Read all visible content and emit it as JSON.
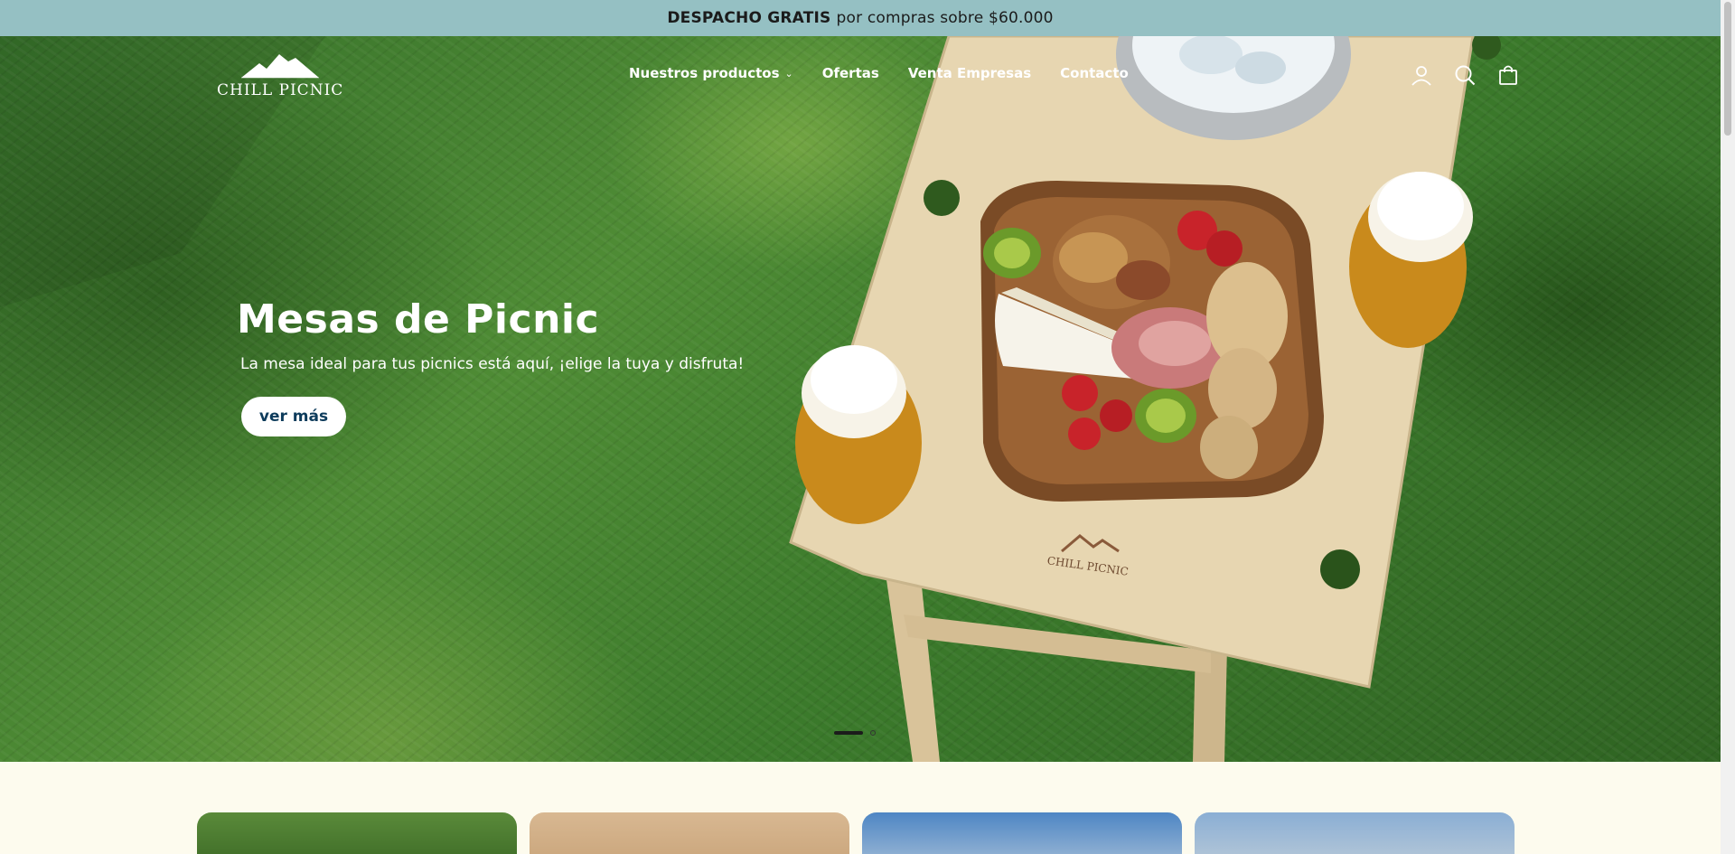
{
  "announcement": {
    "bold": "DESPACHO GRATIS",
    "text": "por compras sobre $60.000"
  },
  "brand": {
    "name": "CHILL PICNIC",
    "logo_icon": "mountain-icon"
  },
  "nav": {
    "items": [
      {
        "label": "Nuestros productos",
        "has_dropdown": true
      },
      {
        "label": "Ofertas"
      },
      {
        "label": "Venta Empresas"
      },
      {
        "label": "Contacto"
      }
    ]
  },
  "header_icons": [
    "account-icon",
    "search-icon",
    "cart-icon"
  ],
  "hero": {
    "title": "Mesas de Picnic",
    "subtitle": "La mesa ideal para tus picnics está aquí, ¡elige la tuya y disfruta!",
    "button_label": "ver más",
    "slides": 2,
    "active_slide": 1,
    "table_branding": "CHILL PICNIC"
  },
  "categories": [
    {
      "name": "category-card-1"
    },
    {
      "name": "category-card-2"
    },
    {
      "name": "category-card-3"
    },
    {
      "name": "category-card-4"
    }
  ],
  "colors": {
    "announcement_bg": "#95c0c3",
    "page_bg": "#fdfbee",
    "button_text": "#0d3b5b"
  }
}
